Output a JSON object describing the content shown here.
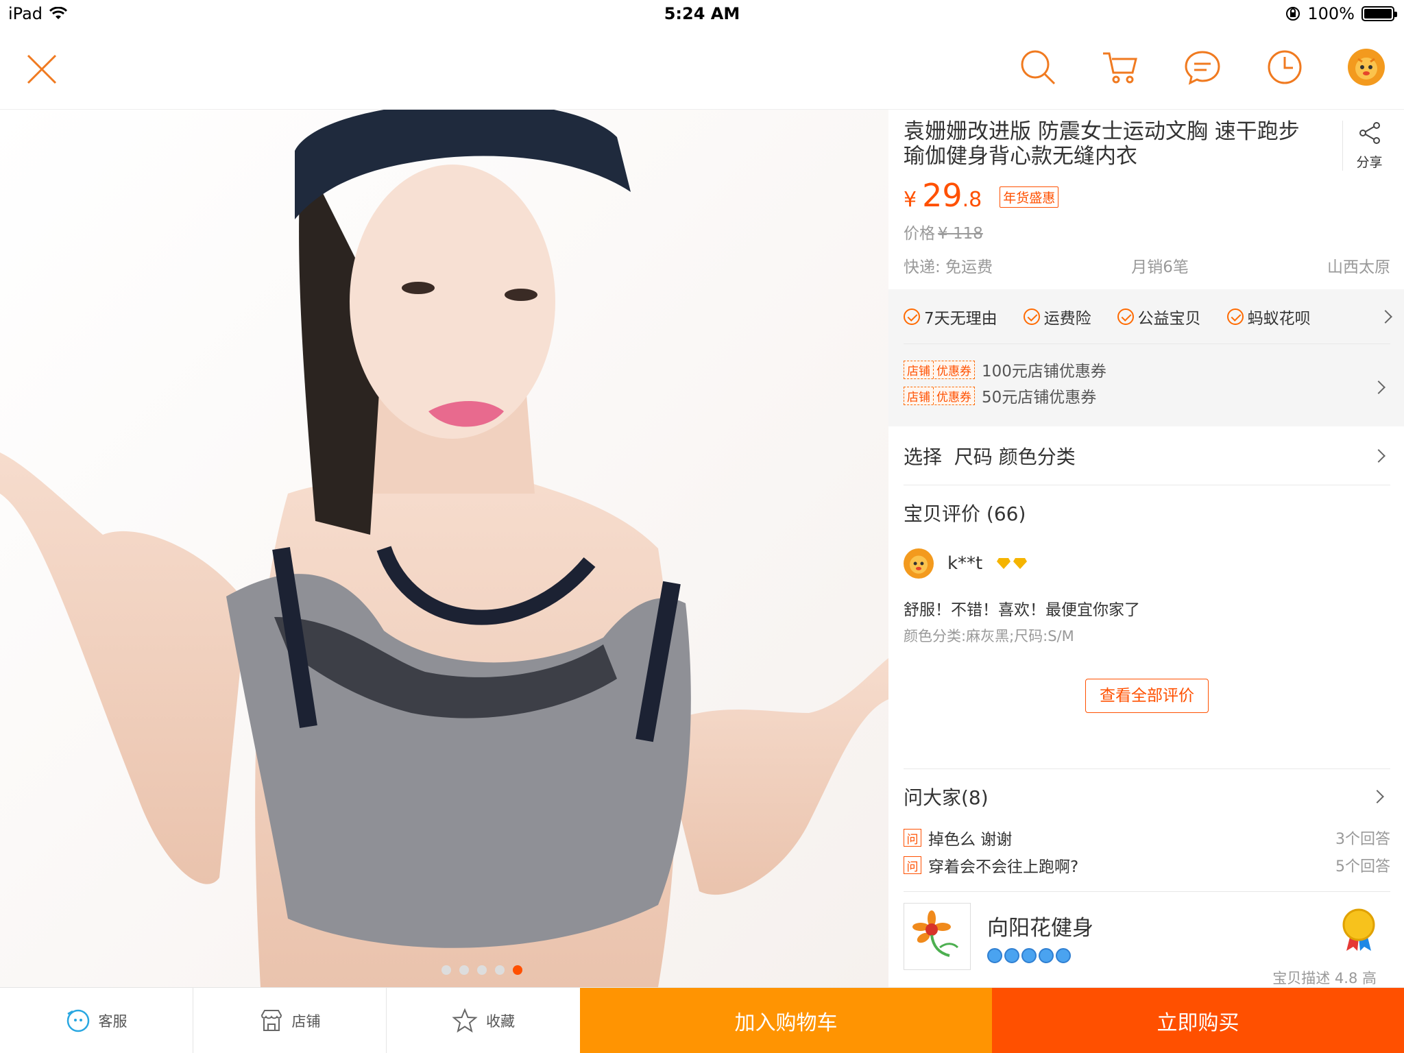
{
  "status_bar": {
    "device": "iPad",
    "time": "5:24 AM",
    "battery": "100%"
  },
  "product": {
    "title": "袁姗姗改进版 防震女士运动文胸 速干跑步瑜伽健身背心款无缝内衣",
    "share_label": "分享",
    "currency": "¥",
    "price_int": "29",
    "price_dec": ".8",
    "promo_tag": "年货盛惠",
    "orig_label": "价格",
    "orig_price": "¥ 118",
    "shipping": "快递: 免运费",
    "monthly_sales": "月销6笔",
    "location": "山西太原",
    "image_count": 5,
    "active_image": 5
  },
  "guarantees": [
    "7天无理由",
    "运费险",
    "公益宝贝",
    "蚂蚁花呗"
  ],
  "coupons": [
    {
      "tag_a": "店铺",
      "tag_b": "优惠券",
      "text": "100元店铺优惠券"
    },
    {
      "tag_a": "店铺",
      "tag_b": "优惠券",
      "text": "50元店铺优惠券"
    }
  ],
  "select_row": "选择  尺码 颜色分类",
  "reviews": {
    "header": "宝贝评价 (66)",
    "reviewer": "k**t",
    "text": "舒服！不错！喜欢！最便宜你家了",
    "sku": "颜色分类:麻灰黑;尺码:S/M",
    "all_button": "查看全部评价"
  },
  "qa": {
    "header": "问大家(8)",
    "q_badge": "问",
    "items": [
      {
        "q": "掉色么 谢谢",
        "count": "3个回答"
      },
      {
        "q": "穿着会不会往上跑啊?",
        "count": "5个回答"
      }
    ]
  },
  "shop": {
    "name": "向阳花健身",
    "rating_peek": "宝贝描述 4.8 高"
  },
  "bottom_bar": {
    "service": "客服",
    "store": "店铺",
    "favorite": "收藏",
    "add_to_cart": "加入购物车",
    "buy_now": "立即购买"
  },
  "colors": {
    "accent": "#ff5000",
    "cart": "#ff9402",
    "icon": "#f07a20"
  }
}
